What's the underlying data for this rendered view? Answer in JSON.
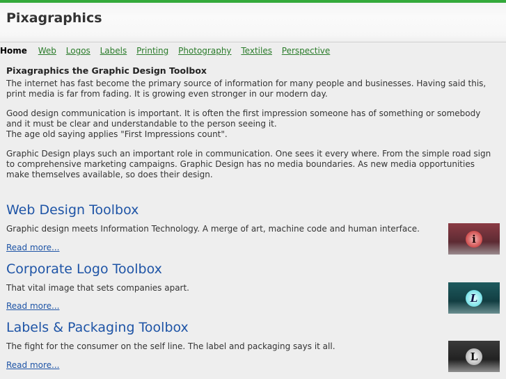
{
  "site": {
    "title": "Pixagraphics"
  },
  "nav": {
    "items": [
      {
        "label": "Home"
      },
      {
        "label": "Web"
      },
      {
        "label": "Logos"
      },
      {
        "label": "Labels"
      },
      {
        "label": "Printing"
      },
      {
        "label": "Photography"
      },
      {
        "label": "Textiles"
      },
      {
        "label": "Perspective"
      }
    ]
  },
  "intro": {
    "title": "Pixagraphics the Graphic Design Toolbox",
    "paragraphs": [
      "The internet has fast become the primary source of information for many people and businesses. Having said this, print media is far from fading. It is growing even stronger in our modern day.",
      "Good design communication is important. It is often the first impression someone has of something or somebody and it must be clear and understandable to the person seeing it.",
      "The age old saying applies \"First Impressions count\".",
      "Graphic Design plays such an important role in communication. One sees it every where. From the simple road sign to comprehensive marketing campaigns. Graphic Design has no media boundaries. As new media opportunities make themselves available, so does their design."
    ]
  },
  "sections": [
    {
      "title": "Web Design Toolbox",
      "description": "Graphic design meets Information Technology. A merge of art, machine code and human interface.",
      "link": "Read more...",
      "thumb_glyph": "i"
    },
    {
      "title": "Corporate Logo Toolbox",
      "description": "That vital image that sets companies apart.",
      "link": "Read more...",
      "thumb_glyph": "L"
    },
    {
      "title": "Labels & Packaging Toolbox",
      "description": "The fight for the consumer on the self line. The label and packaging says it all.",
      "link": "Read more...",
      "thumb_glyph": "L"
    }
  ],
  "colors": {
    "accent_bar": "#33a93a",
    "nav_link": "#2a7b2a",
    "heading_blue": "#1e54a6"
  }
}
